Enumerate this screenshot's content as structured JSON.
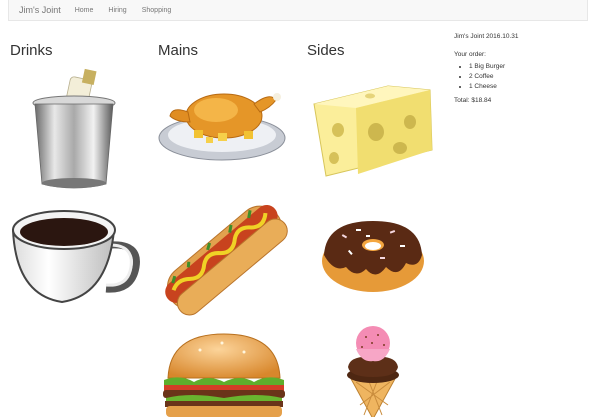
{
  "navbar": {
    "brand": "Jim's Joint",
    "links": [
      "Home",
      "Hiring",
      "Shopping"
    ]
  },
  "columns": {
    "drinks": "Drinks",
    "mains": "Mains",
    "sides": "Sides"
  },
  "items": {
    "drinks": [
      {
        "icon": "champagne-bucket-icon"
      },
      {
        "icon": "coffee-cup-icon"
      }
    ],
    "mains": [
      {
        "icon": "roast-chicken-icon"
      },
      {
        "icon": "hot-dog-icon"
      },
      {
        "icon": "burger-icon"
      }
    ],
    "sides": [
      {
        "icon": "cheese-icon"
      },
      {
        "icon": "donut-icon"
      },
      {
        "icon": "ice-cream-icon"
      }
    ]
  },
  "cart": {
    "title": "Jim's Joint 2016.10.31",
    "order_label": "Your order:",
    "items": [
      "1 Big Burger",
      "2 Coffee",
      "1 Cheese"
    ],
    "total": "Total: $18.84"
  }
}
